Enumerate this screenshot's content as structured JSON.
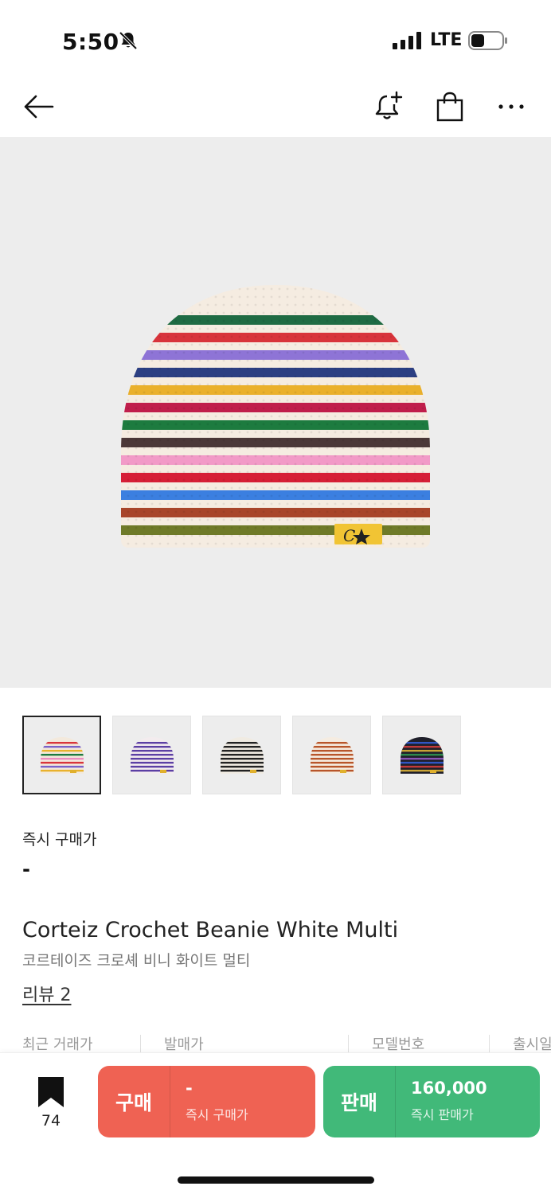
{
  "status": {
    "time": "5:50",
    "network": "LTE"
  },
  "nav": {
    "icons": [
      "back-arrow-icon",
      "bell-plus-icon",
      "shopping-bag-icon",
      "more-icon"
    ]
  },
  "product": {
    "buy_now_label": "즉시 구매가",
    "buy_now_price": "-",
    "title": "Corteiz Crochet Beanie White Multi",
    "subtitle": "코르테이즈 크로셰 비니 화이트 멀티",
    "review_link": "리뷰 2",
    "info_headers": [
      "최근 거래가",
      "발매가",
      "모델번호",
      "출시일"
    ]
  },
  "thumbnails": [
    {
      "variant": "white-multi",
      "selected": true,
      "colors": [
        "#f3e9dc",
        "#d8343b",
        "#7a62c9",
        "#e9b22d",
        "#1d7b3f",
        "#eb8dc0"
      ]
    },
    {
      "variant": "white-purple",
      "selected": false,
      "colors": [
        "#f3ecee",
        "#5b3fa4",
        "#5b3fa4",
        "#5b3fa4",
        "#5b3fa4",
        "#5b3fa4"
      ]
    },
    {
      "variant": "black-white",
      "selected": false,
      "colors": [
        "#f0ebe2",
        "#222222",
        "#222222",
        "#222222",
        "#222222",
        "#222222"
      ]
    },
    {
      "variant": "white-brown",
      "selected": false,
      "colors": [
        "#f5ece1",
        "#b8552a",
        "#b8552a",
        "#b8552a",
        "#b8552a",
        "#b8552a"
      ]
    },
    {
      "variant": "black-multi",
      "selected": false,
      "colors": [
        "#1f1f2a",
        "#3156c5",
        "#c23a3a",
        "#c9a437",
        "#2f8a4c",
        "#8a55b6"
      ]
    }
  ],
  "hero_colors": {
    "base": "#f5ece1",
    "stripes": [
      "#1f6b43",
      "#d8343b",
      "#8e74d6",
      "#2c3f82",
      "#eab02b",
      "#c01e4b",
      "#1d7b3f",
      "#4b3838",
      "#f29ac7",
      "#d61f36",
      "#3b7fe0",
      "#a8452a",
      "#6f7a28"
    ],
    "tag": "#f1c434"
  },
  "bottom_bar": {
    "wish_count": "74",
    "buy": {
      "label": "구매",
      "price": "-",
      "sub": "즉시 구매가",
      "color": "#ef6253"
    },
    "sell": {
      "label": "판매",
      "price": "160,000",
      "sub": "즉시 판매가",
      "color": "#41b979"
    }
  }
}
